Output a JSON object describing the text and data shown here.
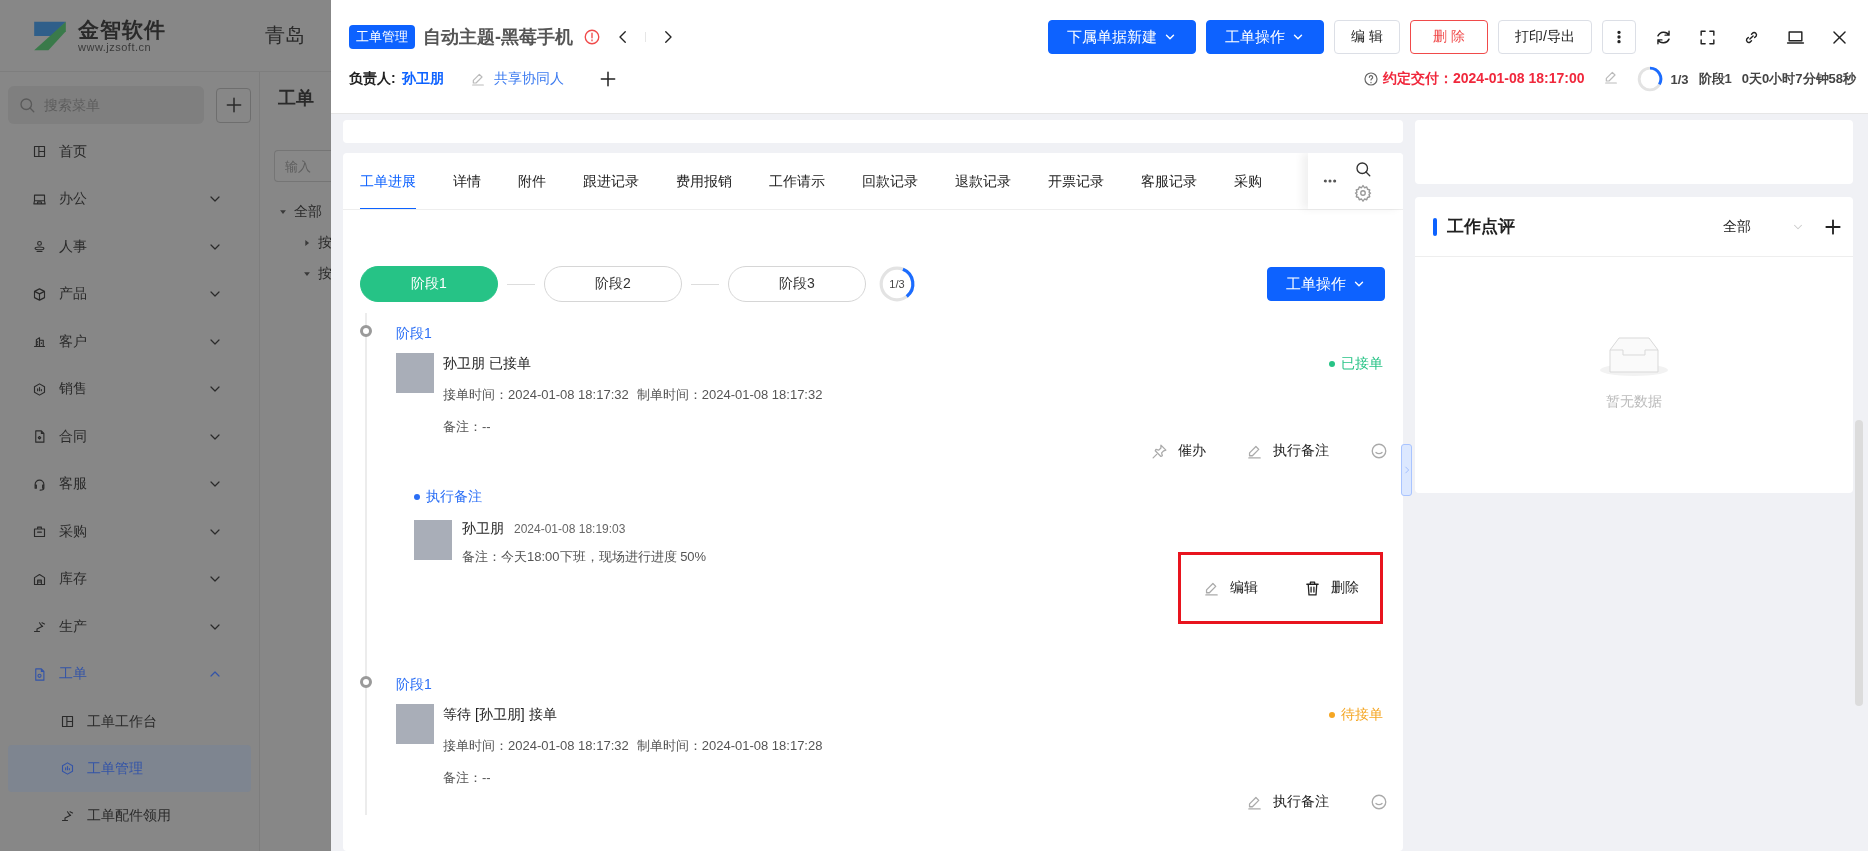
{
  "background_app": {
    "logo": {
      "name": "金智软件",
      "url": "www.jzsoft.cn"
    },
    "header_text": "青岛",
    "search": {
      "placeholder": "搜索菜单"
    },
    "menu": [
      {
        "label": "首页",
        "selected": false
      },
      {
        "label": "办公",
        "expanded": false,
        "selected": false
      },
      {
        "label": "人事",
        "expanded": false,
        "selected": false
      },
      {
        "label": "产品",
        "expanded": false,
        "selected": false
      },
      {
        "label": "客户",
        "expanded": false,
        "selected": false
      },
      {
        "label": "销售",
        "expanded": false,
        "selected": false
      },
      {
        "label": "合同",
        "expanded": false,
        "selected": false
      },
      {
        "label": "客服",
        "expanded": false,
        "selected": false
      },
      {
        "label": "采购",
        "expanded": false,
        "selected": false
      },
      {
        "label": "库存",
        "expanded": false,
        "selected": false
      },
      {
        "label": "生产",
        "expanded": false,
        "selected": false
      },
      {
        "label": "工单",
        "expanded": true,
        "selected": true,
        "children": [
          {
            "label": "工单工作台",
            "selected": false
          },
          {
            "label": "工单管理",
            "selected": true
          },
          {
            "label": "工单配件领用",
            "selected": false
          }
        ]
      }
    ],
    "page_title": "工单",
    "filter": {
      "placeholder": "输入"
    },
    "tree": [
      {
        "label": "全部",
        "expanded": true,
        "children": [
          {
            "label": "按",
            "expanded": false
          },
          {
            "label": "按",
            "expanded": true
          }
        ]
      }
    ]
  },
  "drawer": {
    "tag": "工单管理",
    "title": "自动主题-黑莓手机",
    "buttons": [
      {
        "label": "下属单据新建",
        "kind": "dropdown"
      },
      {
        "label": "工单操作",
        "kind": "dropdown"
      },
      {
        "label": "编 辑",
        "kind": "default"
      },
      {
        "label": "删 除",
        "kind": "danger"
      },
      {
        "label": "打印/导出",
        "kind": "default"
      },
      {
        "kind": "more"
      }
    ],
    "owner_label": "负责人:",
    "owner": "孙卫朋",
    "collaborators_link": "共享协同人",
    "deadline": "约定交付：2024-01-08 18:17:00",
    "progress": {
      "level": 0.333,
      "text": "1/3"
    },
    "current_stage": "阶段1",
    "elapsed": "0天0小时7分钟58秒",
    "tabs": [
      {
        "label": "工单进展",
        "selected": true
      },
      {
        "label": "详情",
        "selected": false
      },
      {
        "label": "附件",
        "selected": false
      },
      {
        "label": "跟进记录",
        "selected": false
      },
      {
        "label": "费用报销",
        "selected": false
      },
      {
        "label": "工作请示",
        "selected": false
      },
      {
        "label": "回款记录",
        "selected": false
      },
      {
        "label": "退款记录",
        "selected": false
      },
      {
        "label": "开票记录",
        "selected": false
      },
      {
        "label": "客服记录",
        "selected": false
      },
      {
        "label": "采购",
        "selected": false
      }
    ],
    "stages": [
      {
        "label": "阶段1",
        "selected": true
      },
      {
        "label": "阶段2",
        "selected": false
      },
      {
        "label": "阶段3",
        "selected": false
      }
    ],
    "stage_progress": {
      "level": 0.333,
      "text": "1/3"
    },
    "operation_button": "工单操作",
    "timeline": [
      {
        "stage": "阶段1",
        "entry": {
          "title": "孙卫朋 已接单",
          "status": "已接单",
          "color": "#27c386",
          "accept_time": "接单时间：2024-01-08 18:17:32",
          "create_time": "制单时间：2024-01-08 18:17:32",
          "note": "备注：--",
          "actions": [
            {
              "kind": "pin",
              "label": "催办"
            },
            {
              "kind": "edit",
              "label": "执行备注"
            },
            {
              "kind": "comment"
            }
          ]
        },
        "notes": {
          "title": "执行备注",
          "items": [
            {
              "author": "孙卫朋",
              "time": "2024-01-08 18:19:03",
              "text": "备注：今天18:00下班，现场进行进度 50%",
              "highlighted": true,
              "actions": [
                {
                  "kind": "edit",
                  "label": "编辑"
                },
                {
                  "kind": "delete",
                  "label": "删除"
                }
              ]
            }
          ]
        }
      },
      {
        "stage": "阶段1",
        "entry": {
          "title": "等待 [孙卫朋] 接单",
          "status": "待接单",
          "color": "#f5a623",
          "accept_time": "接单时间：2024-01-08 18:17:32",
          "create_time": "制单时间：2024-01-08 18:17:28",
          "note": "备注：--",
          "actions": [
            {
              "kind": "edit",
              "label": "执行备注"
            },
            {
              "kind": "comment"
            }
          ]
        }
      }
    ],
    "review": {
      "title": "工作点评",
      "filter": "全部",
      "empty_text": "暂无数据"
    }
  }
}
